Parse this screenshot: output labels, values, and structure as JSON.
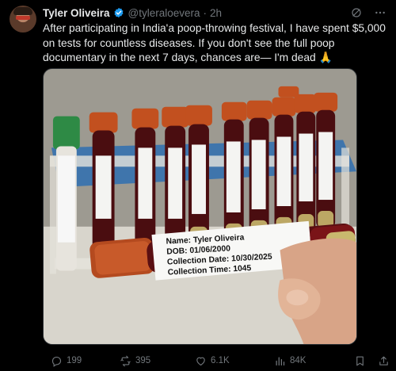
{
  "author": {
    "name": "Tyler Oliveira",
    "handle": "@tyleraloevera",
    "separator": "·",
    "time": "2h"
  },
  "post_text": "After participating in India'a poop-throwing festival, I have spent $5,000 on tests for countless diseases. If you don't see the full poop documentary in the next 7 days, chances are— I'm dead 🙏",
  "media": {
    "label_lines": [
      "Name: Tyler Oliveira",
      "DOB: 01/06/2000",
      "Collection Date: 10/30/2025",
      "Collection Time: 1045"
    ]
  },
  "actions": {
    "replies": "199",
    "reposts": "395",
    "likes": "6.1K",
    "views": "84K"
  },
  "icons": [
    "verified-badge-icon",
    "grok-icon",
    "more-icon",
    "reply-icon",
    "repost-icon",
    "like-icon",
    "views-icon",
    "bookmark-icon",
    "share-icon"
  ],
  "colors": {
    "background": "#000000",
    "text": "#e7e9ea",
    "muted": "#71767b",
    "verified": "#1d9bf0"
  }
}
